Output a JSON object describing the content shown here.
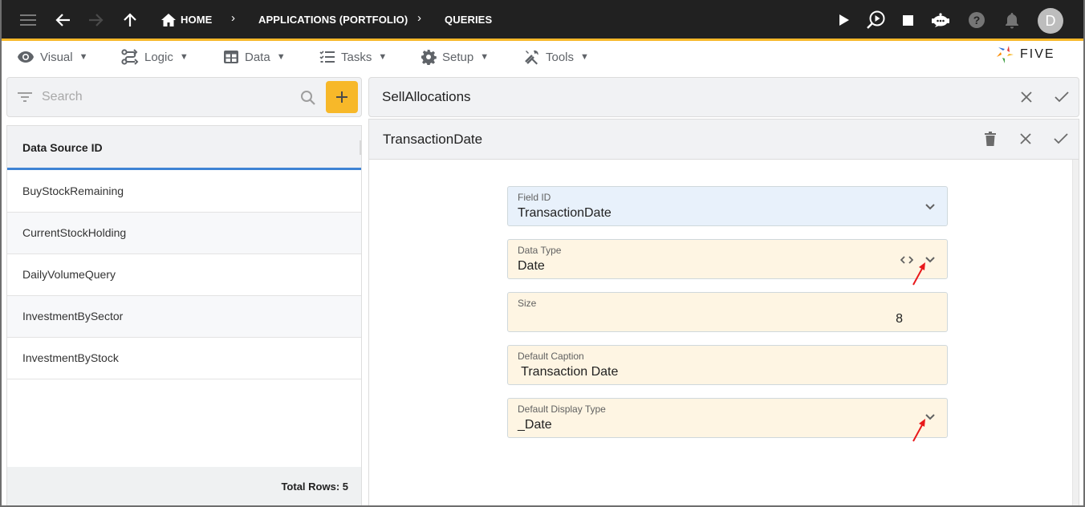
{
  "topbar": {
    "breadcrumbs": [
      {
        "label": "HOME",
        "icon": "home-icon"
      },
      {
        "label": "APPLICATIONS (PORTFOLIO)"
      },
      {
        "label": "QUERIES"
      }
    ],
    "separator": "›",
    "avatar_letter": "D",
    "icons": [
      "menu-icon",
      "back-arrow-icon",
      "forward-arrow-icon",
      "up-arrow-icon",
      "play-icon",
      "inspect-play-icon",
      "stop-icon",
      "chatbot-icon",
      "help-icon",
      "bell-icon"
    ]
  },
  "menubar": {
    "items": [
      {
        "label": "Visual",
        "icon": "eye-icon"
      },
      {
        "label": "Logic",
        "icon": "flow-icon"
      },
      {
        "label": "Data",
        "icon": "table-icon"
      },
      {
        "label": "Tasks",
        "icon": "checklist-icon"
      },
      {
        "label": "Setup",
        "icon": "gear-icon"
      },
      {
        "label": "Tools",
        "icon": "tools-icon"
      }
    ],
    "caret": "▼",
    "logo_text": "FIVE"
  },
  "left": {
    "search_placeholder": "Search",
    "add_label": "+",
    "column_header": "Data Source ID",
    "rows": [
      "BuyStockRemaining",
      "CurrentStockHolding",
      "DailyVolumeQuery",
      "InvestmentBySector",
      "InvestmentByStock"
    ],
    "footer": "Total Rows: 5"
  },
  "right": {
    "parent_title": "SellAllocations",
    "detail_title": "TransactionDate",
    "fields": [
      {
        "label": "Field ID",
        "value": "TransactionDate"
      },
      {
        "label": "Data Type",
        "value": "Date"
      },
      {
        "label": "Size",
        "value": "8"
      },
      {
        "label": "Default Caption",
        "value": " Transaction Date"
      },
      {
        "label": "Default Display Type",
        "value": "_Date"
      }
    ]
  },
  "colors": {
    "accent": "#f7b829",
    "topbar": "#212121",
    "selected_underline": "#3f83d4",
    "field_blue": "#e8f1fb",
    "field_yellow": "#fef5e3",
    "annotation_arrow": "#e8191b"
  }
}
